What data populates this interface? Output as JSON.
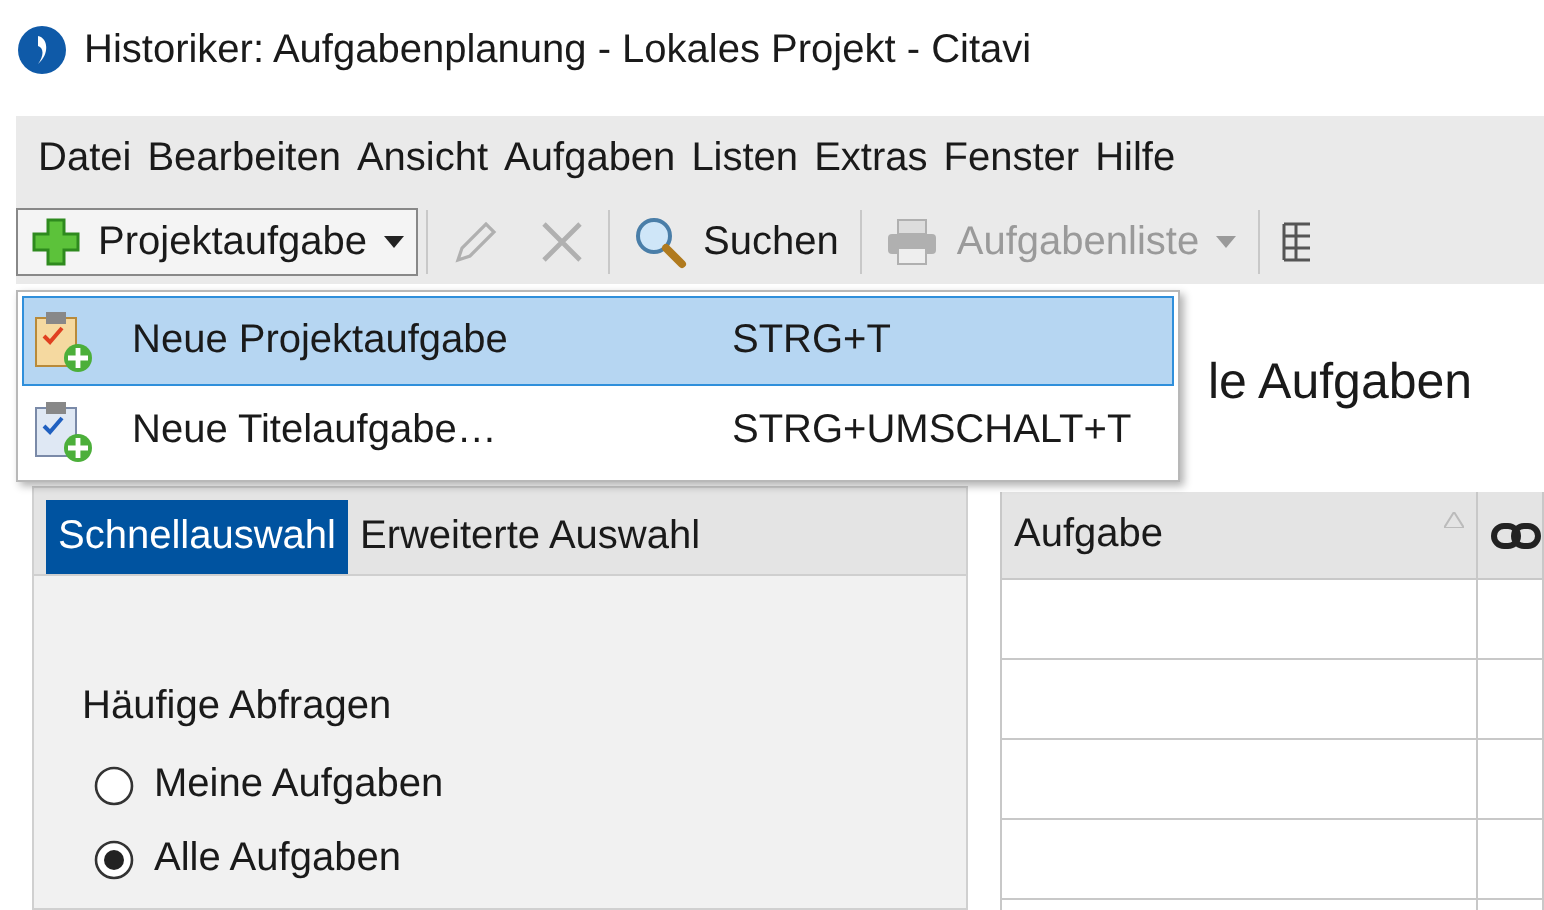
{
  "window": {
    "title": "Historiker: Aufgabenplanung - Lokales Projekt - Citavi"
  },
  "menu_bar": [
    "Datei",
    "Bearbeiten",
    "Ansicht",
    "Aufgaben",
    "Listen",
    "Extras",
    "Fenster",
    "Hilfe"
  ],
  "toolbar": [
    {
      "kind": "add",
      "label": "Projektaufgabe",
      "disabled": false,
      "expanded": true
    },
    {
      "kind": "edit",
      "disabled": true
    },
    {
      "kind": "delete",
      "disabled": true
    },
    {
      "kind": "search",
      "label": "Suchen",
      "disabled": false
    },
    {
      "kind": "print",
      "label": "Aufgabenliste",
      "disabled": true
    },
    {
      "kind": "grid",
      "disabled": false
    }
  ],
  "dropdown_menu": {
    "items": [
      {
        "kind": "project",
        "label": "Neue Projektaufgabe",
        "shortcut": "STRG+T",
        "selected": true
      },
      {
        "kind": "title",
        "label": "Neue Titelaufgabe…",
        "shortcut": "STRG+UMSCHALT+T",
        "selected": false
      }
    ]
  },
  "heading": "le Aufgaben",
  "left_panel": {
    "tabs": [
      {
        "label": "Schnellauswahl",
        "selected": true
      },
      {
        "label": "Erweiterte Auswahl",
        "selected": false
      }
    ],
    "group_label": "Häufige Abfragen",
    "radios": [
      {
        "label": "Meine Aufgaben",
        "selected": false
      },
      {
        "label": "Alle Aufgaben",
        "selected": true
      }
    ]
  },
  "table": {
    "columns": [
      {
        "kind": "text",
        "label": "Aufgabe"
      },
      {
        "kind": "link"
      }
    ]
  }
}
